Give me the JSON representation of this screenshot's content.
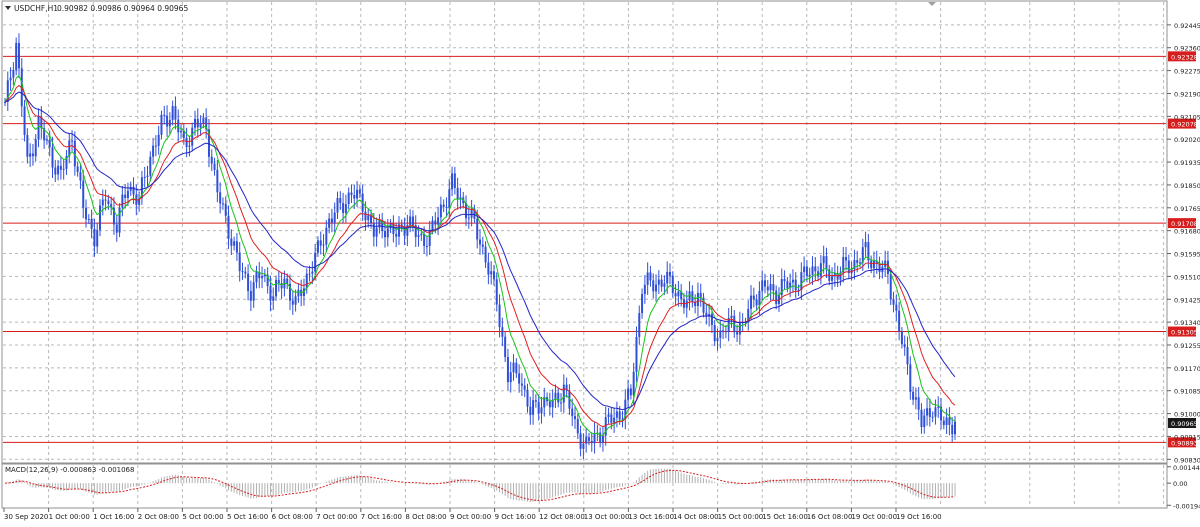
{
  "header": {
    "symbol_label": "USDCHF,H1",
    "ohlc_text": "0.90982 0.90986 0.90964 0.90965"
  },
  "colors": {
    "background": "#ffffff",
    "grid": "#b8b8b8",
    "candles": "#2f4fd8",
    "ma_fast": "#19c419",
    "ma_mid": "#e02020",
    "ma_slow": "#2323c8",
    "hlines": "#d81d1d",
    "macd_hist": "#b0b0b0",
    "macd_signal": "#d81d1d"
  },
  "chart_data": [
    {
      "type": "line",
      "title": "USDCHF,H1",
      "ylim": [
        0.9082,
        0.9253
      ],
      "y_ticks": [
        "0.92445",
        "0.92360",
        "0.92275",
        "0.92190",
        "0.92105",
        "0.92020",
        "0.91935",
        "0.91850",
        "0.91765",
        "0.91680",
        "0.91595",
        "0.91510",
        "0.91425",
        "0.91340",
        "0.91255",
        "0.91170",
        "0.91085",
        "0.91000",
        "0.90915",
        "0.90830"
      ],
      "x_ticks": [
        "30 Sep 2020",
        "1 Oct 00:00",
        "1 Oct 16:00",
        "2 Oct 08:00",
        "5 Oct 00:00",
        "5 Oct 16:00",
        "6 Oct 08:00",
        "7 Oct 00:00",
        "7 Oct 16:00",
        "8 Oct 08:00",
        "9 Oct 00:00",
        "9 Oct 16:00",
        "12 Oct 08:00",
        "13 Oct 00:00",
        "13 Oct 16:00",
        "14 Oct 08:00",
        "15 Oct 00:00",
        "15 Oct 16:00",
        "16 Oct 08:00",
        "19 Oct 00:00",
        "19 Oct 16:00"
      ],
      "horizontal_levels": [
        {
          "value": 0.92328,
          "label": "0.92328"
        },
        {
          "value": 0.92078,
          "label": "0.92078"
        },
        {
          "value": 0.91708,
          "label": "0.91708"
        },
        {
          "value": 0.91305,
          "label": "0.91305"
        },
        {
          "value": 0.90893,
          "label": "0.90893"
        }
      ],
      "current_price": {
        "value": 0.90965,
        "label": "0.90965"
      },
      "close_series": [
        0.9214,
        0.9238,
        0.9192,
        0.9208,
        0.9197,
        0.9188,
        0.9203,
        0.9176,
        0.9166,
        0.9181,
        0.917,
        0.9185,
        0.9179,
        0.9196,
        0.9207,
        0.9213,
        0.9199,
        0.9208,
        0.9206,
        0.9182,
        0.9169,
        0.9154,
        0.9146,
        0.9152,
        0.9144,
        0.915,
        0.914,
        0.9151,
        0.916,
        0.9172,
        0.9177,
        0.9182,
        0.9178,
        0.9167,
        0.917,
        0.9166,
        0.9172,
        0.9165,
        0.9166,
        0.9176,
        0.9185,
        0.9178,
        0.917,
        0.9158,
        0.9142,
        0.9114,
        0.9115,
        0.91,
        0.9105,
        0.9103,
        0.911,
        0.9095,
        0.9088,
        0.9092,
        0.9097,
        0.91,
        0.9107,
        0.9148,
        0.9148,
        0.915,
        0.9146,
        0.914,
        0.9145,
        0.9133,
        0.9129,
        0.9134,
        0.9132,
        0.9144,
        0.9147,
        0.9145,
        0.9148,
        0.9149,
        0.9153,
        0.9155,
        0.9151,
        0.9154,
        0.9156,
        0.916,
        0.9155,
        0.9152,
        0.9131,
        0.9112,
        0.9096,
        0.9103,
        0.9096,
        0.9097
      ],
      "series": [
        {
          "name": "",
          "period_hint": "fast",
          "values": []
        },
        {
          "name": "",
          "period_hint": "mid",
          "values": []
        },
        {
          "name": "",
          "period_hint": "slow",
          "values": []
        }
      ]
    },
    {
      "type": "bar",
      "title": "MACD(12,26,9) -0.000863 -0.001068",
      "ylim": [
        -0.0021,
        0.0016
      ],
      "y_ticks": [
        "0.001444",
        "0.00",
        "-0.001949"
      ]
    }
  ],
  "macd": {
    "label": "MACD(12,26,9) -0.000863 -0.001068"
  }
}
